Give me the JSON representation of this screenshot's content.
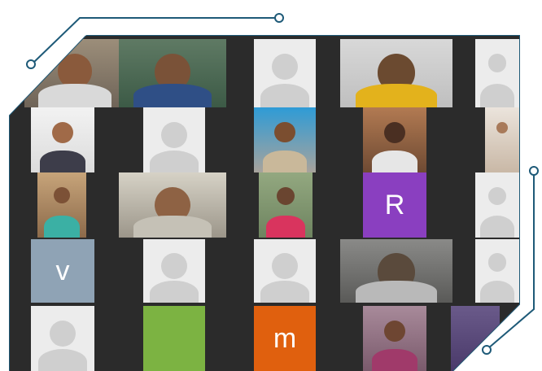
{
  "meeting_grid": {
    "letter_tiles": {
      "v": "v",
      "r": "R",
      "m": "m"
    },
    "colors": {
      "frame_accent": "#1e5a78",
      "letter_v_bg": "#8fa3b5",
      "letter_r_bg": "#8a3fc0",
      "letter_m_bg": "#e0600e",
      "green_tile_bg": "#7cb342"
    }
  }
}
